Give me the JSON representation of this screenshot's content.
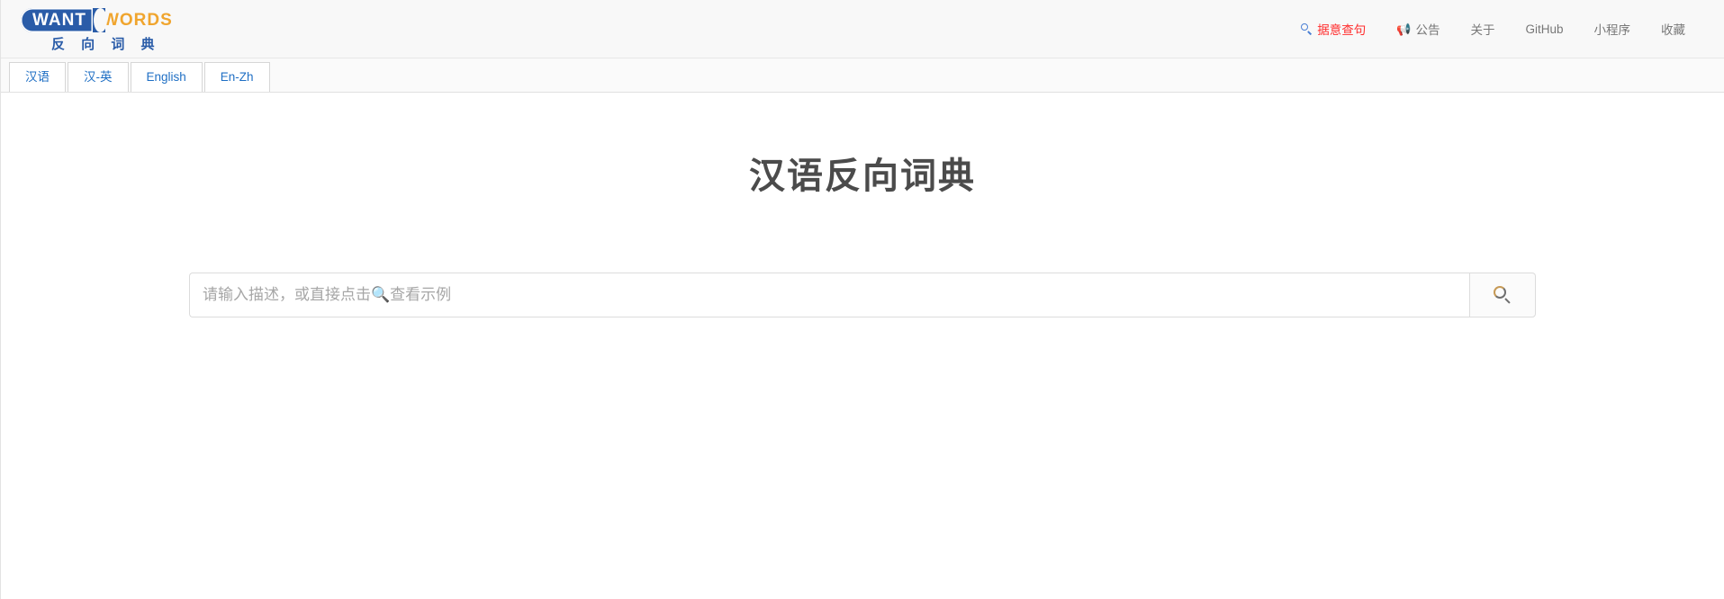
{
  "brand": {
    "badge_text": "WANT",
    "words_text": "WORDS",
    "subtitle": "反 向 词 典"
  },
  "nav": {
    "items": [
      {
        "label": "据意查句",
        "icon": "search-icon",
        "color": "#ff2d2d"
      },
      {
        "label": "公告",
        "icon": "megaphone-icon",
        "glyph": "📢",
        "color": "#777777"
      },
      {
        "label": "关于",
        "icon": "",
        "color": "#777777"
      },
      {
        "label": "GitHub",
        "icon": "",
        "color": "#777777"
      },
      {
        "label": "小程序",
        "icon": "",
        "color": "#777777"
      },
      {
        "label": "收藏",
        "icon": "",
        "color": "#777777"
      }
    ]
  },
  "tabs": [
    {
      "label": "汉语",
      "active": true
    },
    {
      "label": "汉-英",
      "active": false
    },
    {
      "label": "English",
      "active": false
    },
    {
      "label": "En-Zh",
      "active": false
    }
  ],
  "main": {
    "title": "汉语反向词典",
    "search": {
      "value": "",
      "placeholder": "请输入描述，或直接点击🔍查看示例",
      "button_icon": "search-icon"
    }
  },
  "colors": {
    "brand_blue": "#2a5ca8",
    "brand_orange": "#f0a52e",
    "tab_blue": "#1f6fc4",
    "highlight_red": "#ff2d2d",
    "title_gray": "#4b4b4b"
  }
}
